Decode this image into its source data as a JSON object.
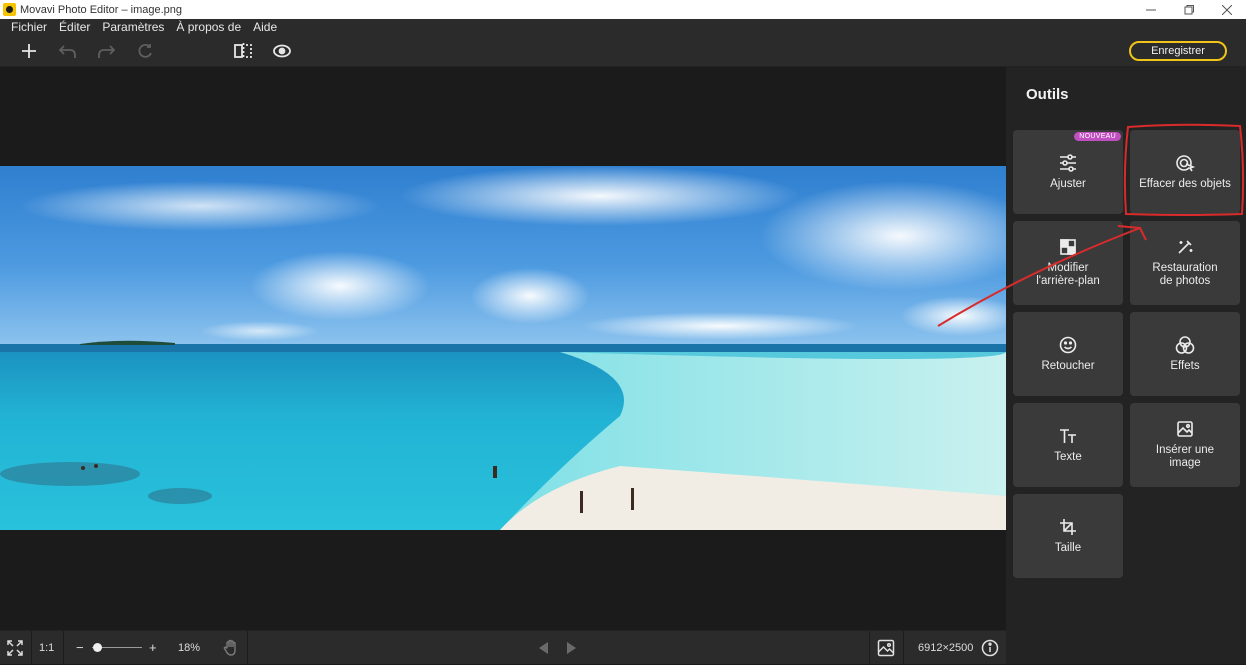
{
  "window": {
    "title": "Movavi Photo Editor – image.png",
    "controls": [
      "minimize-icon",
      "maximize-icon",
      "close-icon"
    ]
  },
  "menu": {
    "items": [
      "Fichier",
      "Éditer",
      "Paramètres",
      "À propos de",
      "Aide"
    ]
  },
  "toolbar": {
    "icons": [
      "add-icon",
      "undo-icon",
      "redo-icon",
      "reset-icon",
      "compare-icon",
      "preview-eye-icon"
    ],
    "save_label": "Enregistrer",
    "accent": "#f0c419"
  },
  "panel": {
    "title": "Outils",
    "tools": [
      {
        "label": "Ajuster",
        "icon": "sliders-icon",
        "badge": "NOUVEAU"
      },
      {
        "label": "Effacer des objets",
        "icon": "eraser-cursor-icon"
      },
      {
        "label": "Modifier\nl'arrière-plan",
        "icon": "checkerboard-icon"
      },
      {
        "label": "Restauration\nde photos",
        "icon": "magic-wand-icon"
      },
      {
        "label": "Retoucher",
        "icon": "smiley-icon"
      },
      {
        "label": "Effets",
        "icon": "circles-icon"
      },
      {
        "label": "Texte",
        "icon": "text-tt-icon"
      },
      {
        "label": "Insérer une\nimage",
        "icon": "image-insert-icon"
      },
      {
        "label": "Taille",
        "icon": "crop-icon"
      }
    ],
    "badge_color": "#c04fc0"
  },
  "bottom": {
    "ratio_label": "1:1",
    "zoom_minus": "−",
    "zoom_plus": "+",
    "zoom_level": "18%",
    "dimensions": "6912×2500",
    "icons": [
      "fullscreen-icon",
      "hand-icon",
      "prev-arrow-icon",
      "next-arrow-icon",
      "image-icon",
      "info-icon"
    ]
  },
  "annotation": {
    "color": "#d92b2b"
  }
}
